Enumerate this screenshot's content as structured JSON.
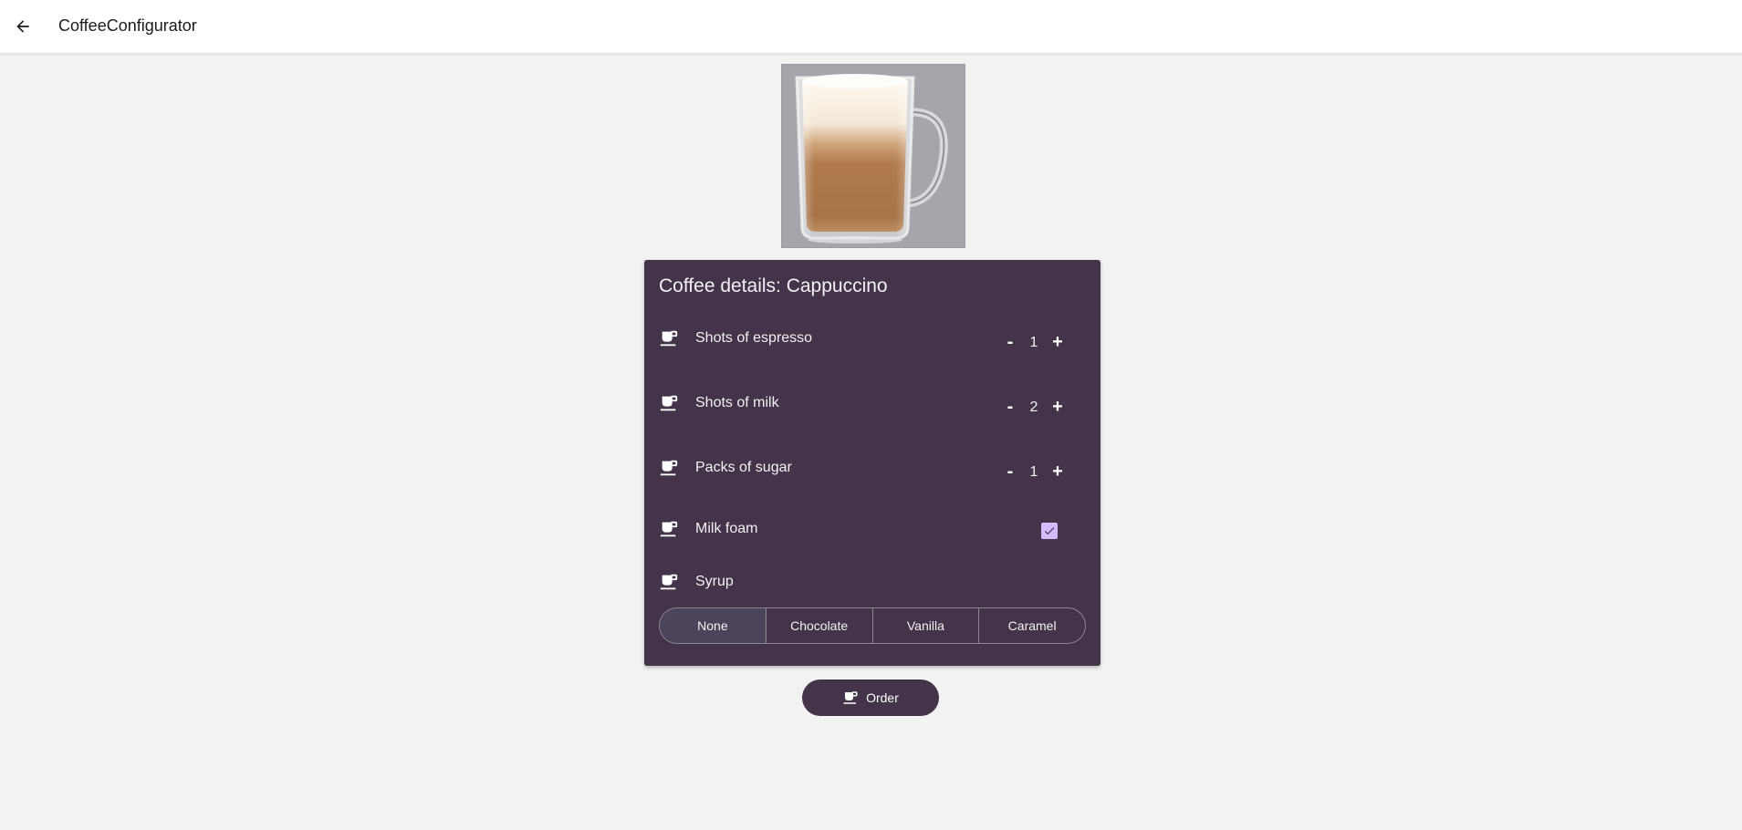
{
  "appbar": {
    "title": "CoffeeConfigurator",
    "back_icon": "arrow-left-icon"
  },
  "image": {
    "description_icon": "cappuccino-glass"
  },
  "card": {
    "title": "Coffee details: Cappuccino",
    "rows": [
      {
        "label": "Shots of espresso",
        "value": "1",
        "minus": "-",
        "plus": "+"
      },
      {
        "label": "Shots of milk",
        "value": "2",
        "minus": "-",
        "plus": "+"
      },
      {
        "label": "Packs of sugar",
        "value": "1",
        "minus": "-",
        "plus": "+"
      },
      {
        "label": "Milk foam",
        "checked": true
      },
      {
        "label": "Syrup"
      }
    ],
    "syrup_options": [
      "None",
      "Chocolate",
      "Vanilla",
      "Caramel"
    ],
    "syrup_selected": "None",
    "row_icon": "coffee-cup-icon"
  },
  "order": {
    "label": "Order",
    "icon": "coffee-cup-icon"
  },
  "colors": {
    "card_bg": "#44344a",
    "checkbox": "#d2bcfd",
    "page_bg": "#f2f2f2"
  }
}
